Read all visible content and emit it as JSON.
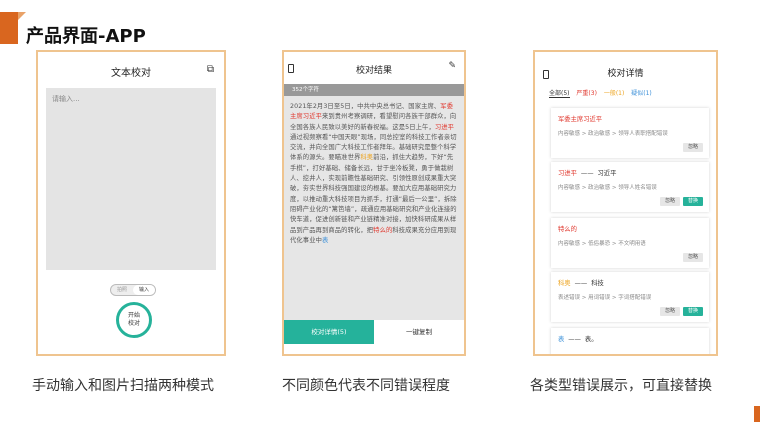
{
  "page": {
    "title": "产品界面-APP"
  },
  "colors": {
    "accent": "#d9661f",
    "panel_border": "#efc48f",
    "teal": "#26b29a",
    "severe": "#e0372d",
    "general": "#eda522",
    "suspect": "#3a8fd8"
  },
  "panel1": {
    "title": "文本校对",
    "title_icon": "scan-icon",
    "placeholder": "请输入...",
    "toggle_left": "拍照",
    "toggle_right": "输入",
    "start_line1": "开始",
    "start_line2": "校对",
    "caption": "手动输入和图片扫描两种模式"
  },
  "panel2": {
    "title": "校对结果",
    "char_count": "352个字符",
    "text": {
      "p1": "2021年2月3日至5日，中共中央总书记、国家主席、",
      "e1": "军委主席习近平",
      "p2": "来到贵州考察调研，看望慰问各族干部群众，向全国各族人民致以美好的新春祝福。这是5日上午，",
      "e2": "习进平",
      "p3": "通过视频察看“中国天眼”现场，同总控室的科技工作者亲切交流，并向全国广大科技工作者拜年。基础研究是整个科学体系的源头。要瞄准世界",
      "e3": "科奥",
      "p4": "前沿，抓住大趋势，下好“先手棋”，打好基础、储备长远，甘于坐冷板凳，勇于做栽树人、挖井人，实现前瞻性基础研究、引领性原创成果重大突破，夯实世界科技强国建设的根基。要加大应用基础研究力度，以推动重大科技项目为抓手，打通“最后一公里”，拆除阻碍产业化的“篱笆墙”，疏通应用基础研究和产业化连接的快车道，促进创新链和产业链精准对接，加快科研成果从样品到产品再到商品的转化，把",
      "e4": "特么的",
      "p5": "科技成果充分应用到现代化事业中",
      "e5": "表"
    },
    "tab_details": "校对详情(5)",
    "tab_copy": "一键复制",
    "caption": "不同颜色代表不同错误程度"
  },
  "panel3": {
    "title": "校对详情",
    "filters": {
      "all": "全部(5)",
      "severe": "严重(3)",
      "general": "一般(1)",
      "suspect": "疑似(1)"
    },
    "cards": [
      {
        "word": "军委主席习近平",
        "correction": "",
        "path": "内容敏感 > 政治敏感 > 领导人表职搭配错误",
        "buttons": [
          "忽略"
        ]
      },
      {
        "word": "习进平",
        "correction": "习近平",
        "path": "内容敏感 > 政治敏感 > 领导人姓名错误",
        "buttons": [
          "忽略",
          "替换"
        ]
      },
      {
        "word": "特么的",
        "correction": "",
        "path": "内容敏感 > 低俗暴恐 > 不文明用语",
        "buttons": [
          "忽略"
        ]
      },
      {
        "word": "科奥",
        "correction": "科技",
        "path": "表述错误 > 用词错误 > 字词搭配错误",
        "buttons": [
          "忽略",
          "替换"
        ]
      },
      {
        "word": "表",
        "correction": "表。",
        "path": "",
        "buttons": []
      }
    ],
    "caption": "各类型错误展示，可直接替换"
  }
}
